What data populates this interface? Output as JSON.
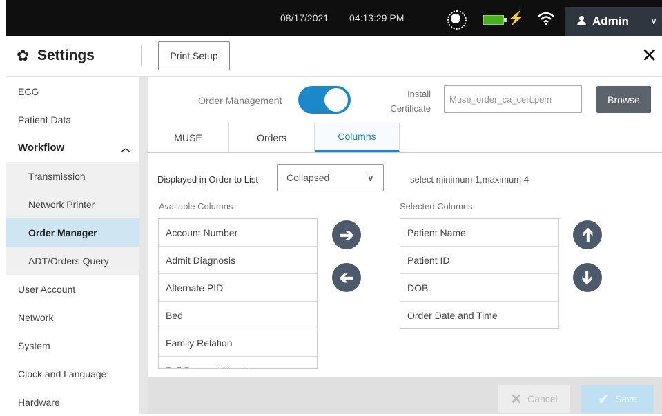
{
  "status_bar": {
    "date": "08/17/2021",
    "time": "04:13:29 PM",
    "user": "Admin",
    "battery_color": "#4caf1f"
  },
  "header": {
    "title": "Settings",
    "print_setup": "Print Setup"
  },
  "sidebar": {
    "items": [
      {
        "label": "ECG"
      },
      {
        "label": "Patient Data"
      },
      {
        "label": "Workflow"
      },
      {
        "label": "Transmission"
      },
      {
        "label": "Network Printer"
      },
      {
        "label": "Order Manager"
      },
      {
        "label": "ADT/Orders Query"
      },
      {
        "label": "User Account"
      },
      {
        "label": "Network"
      },
      {
        "label": "System"
      },
      {
        "label": "Clock and Language"
      },
      {
        "label": "Hardware"
      }
    ],
    "active": "Order Manager"
  },
  "main": {
    "order_management_label": "Order Management",
    "order_management_enabled": true,
    "install_certificate_label_1": "Install",
    "install_certificate_label_2": "Certificate",
    "certificate_file": "Muse_order_ca_cert.pem",
    "browse": "Browse",
    "tabs": [
      {
        "label": "MUSE"
      },
      {
        "label": "Orders"
      },
      {
        "label": "Columns"
      }
    ],
    "active_tab": "Columns",
    "displayed_label": "Displayed in Order to List",
    "displayed_value": "Collapsed",
    "limit_hint": "select minimum 1,maximum 4",
    "available_header": "Available Columns",
    "selected_header": "Selected Columns",
    "available_columns": [
      "Account Number",
      "Admit Diagnosis",
      "Alternate PID",
      "Bed",
      "Family Relation",
      "Full Request Number"
    ],
    "selected_columns": [
      "Patient Name",
      "Patient ID",
      "DOB",
      "Order Date and Time"
    ]
  },
  "footer": {
    "cancel": "Cancel",
    "save": "Save"
  },
  "colors": {
    "accent": "#1a88c9",
    "active_row": "#cfe6f2",
    "round_button": "#4c5a6b"
  }
}
